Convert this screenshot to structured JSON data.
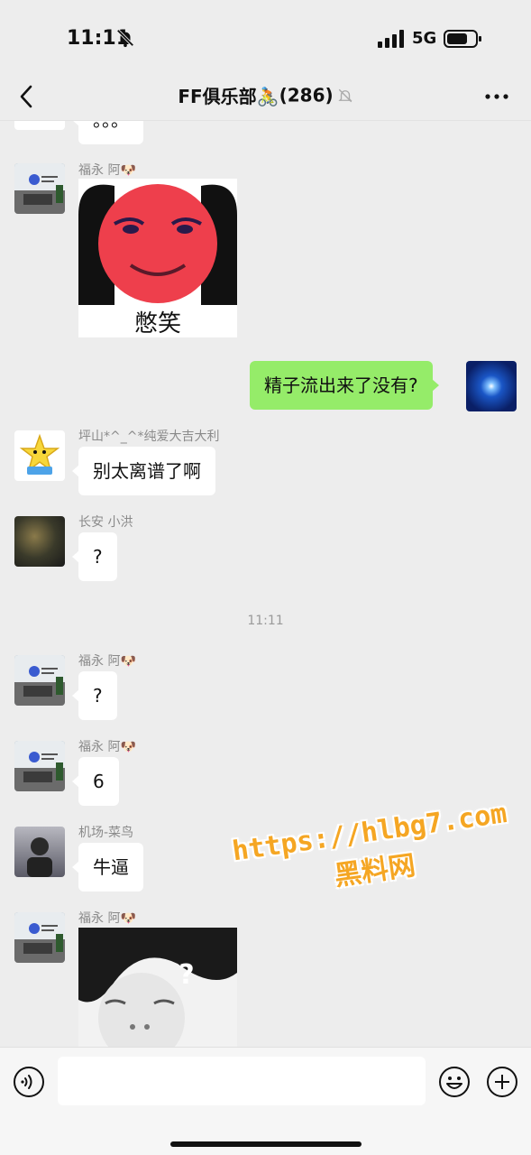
{
  "status_bar": {
    "time": "11:11",
    "network": "5G"
  },
  "header": {
    "title": "FF俱乐部🚴",
    "count": "(286)"
  },
  "messages": [
    {
      "sender": "",
      "text": "。。。"
    },
    {
      "sender": "福永 阿🐶",
      "sticker_text": "憋笑"
    },
    {
      "sender": "me",
      "text": "精子流出来了没有?"
    },
    {
      "sender": "坪山*^_^*纯爱大吉大利",
      "text": "别太离谱了啊"
    },
    {
      "sender": "长安 小洪",
      "text": "?"
    },
    {
      "sender": "福永 阿🐶",
      "text": "?"
    },
    {
      "sender": "福永 阿🐶",
      "text": "6"
    },
    {
      "sender": "机场-菜鸟",
      "text": "牛逼"
    },
    {
      "sender": "福永 阿🐶",
      "sticker_text": "?"
    }
  ],
  "timestamp": "11:11",
  "watermark": {
    "url": "https://hlbg7.com",
    "name": "黑料网"
  },
  "icons": [
    "back-icon",
    "mute-icon",
    "more-icon",
    "voice-icon",
    "emoji-icon",
    "plus-icon"
  ],
  "colors": {
    "background": "#ededed",
    "my_bubble": "#95ec69",
    "bubble": "#ffffff",
    "watermark": "#f5a623"
  }
}
